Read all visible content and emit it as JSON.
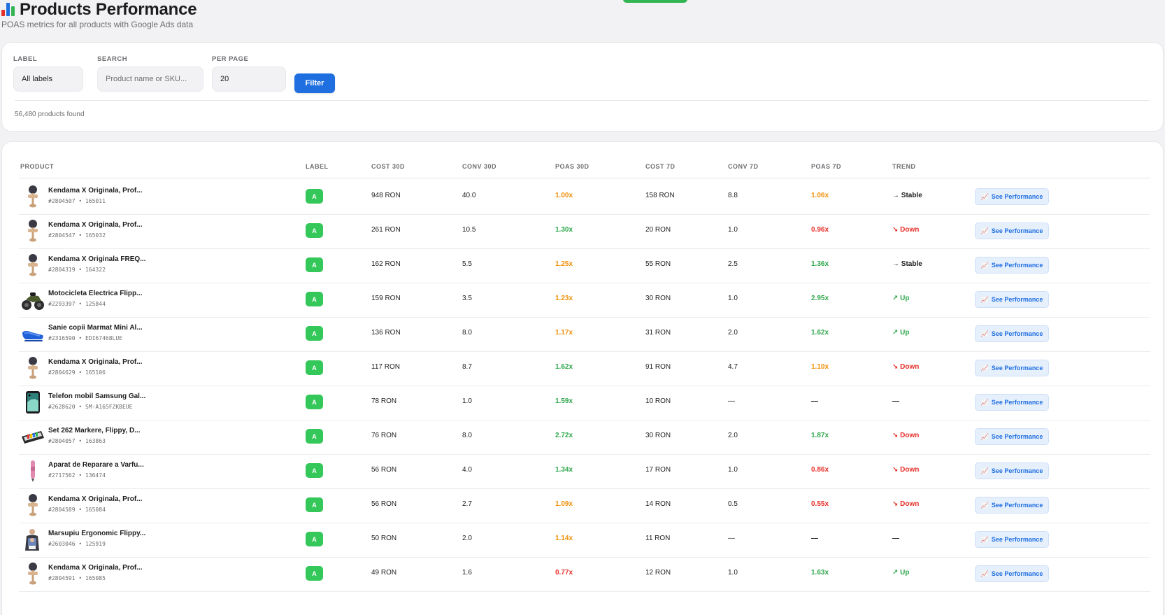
{
  "colors": {
    "accent": "#1f6fe0",
    "badge_green": "#34c759",
    "poas_green": "#30a84d",
    "poas_orange": "#f0900a",
    "poas_red": "#e5302a"
  },
  "header": {
    "icon": "bar-chart-icon",
    "title": "Products Performance",
    "subtitle": "POAS metrics for all products with Google Ads data"
  },
  "filters": {
    "label_label": "LABEL",
    "label_value": "All labels",
    "search_label": "SEARCH",
    "search_placeholder": "Product name or SKU...",
    "per_page_label": "PER PAGE",
    "per_page_value": "20",
    "filter_button": "Filter",
    "count_text": "56,480 products found"
  },
  "table": {
    "headers": {
      "product": "PRODUCT",
      "label": "LABEL",
      "cost30": "COST 30D",
      "conv30": "CONV 30D",
      "poas30": "POAS 30D",
      "cost7": "COST 7D",
      "conv7": "CONV 7D",
      "poas7": "POAS 7D",
      "trend": "TREND"
    },
    "action_label": "See Performance",
    "action_icon": "chart-increasing-icon",
    "rows": [
      {
        "name": "Kendama X Originala, Prof...",
        "sku": "#2804507 • 165011",
        "image": "kendama",
        "label": "A",
        "cost30": "948 RON",
        "conv30": "40.0",
        "poas30": "1.00x",
        "poas30_color": "orange",
        "cost7": "158 RON",
        "conv7": "8.8",
        "poas7": "1.06x",
        "poas7_color": "orange",
        "trend": "→ Stable",
        "trend_color": "dark"
      },
      {
        "name": "Kendama X Originala, Prof...",
        "sku": "#2804547 • 165032",
        "image": "kendama",
        "label": "A",
        "cost30": "261 RON",
        "conv30": "10.5",
        "poas30": "1.30x",
        "poas30_color": "green",
        "cost7": "20 RON",
        "conv7": "1.0",
        "poas7": "0.96x",
        "poas7_color": "red",
        "trend": "↘ Down",
        "trend_color": "red"
      },
      {
        "name": "Kendama X Originala FREQ...",
        "sku": "#2804319 • 164322",
        "image": "kendama",
        "label": "A",
        "cost30": "162 RON",
        "conv30": "5.5",
        "poas30": "1.25x",
        "poas30_color": "orange",
        "cost7": "55 RON",
        "conv7": "2.5",
        "poas7": "1.36x",
        "poas7_color": "green",
        "trend": "→ Stable",
        "trend_color": "dark"
      },
      {
        "name": "Motocicleta Electrica Flipp...",
        "sku": "#2293397 • 125844",
        "image": "motorcycle",
        "label": "A",
        "cost30": "159 RON",
        "conv30": "3.5",
        "poas30": "1.23x",
        "poas30_color": "orange",
        "cost7": "30 RON",
        "conv7": "1.0",
        "poas7": "2.95x",
        "poas7_color": "green",
        "trend": "↗ Up",
        "trend_color": "green"
      },
      {
        "name": "Sanie copii Marmat Mini Al...",
        "sku": "#2316590 • EDI67468LUE",
        "image": "sled",
        "label": "A",
        "cost30": "136 RON",
        "conv30": "8.0",
        "poas30": "1.17x",
        "poas30_color": "orange",
        "cost7": "31 RON",
        "conv7": "2.0",
        "poas7": "1.62x",
        "poas7_color": "green",
        "trend": "↗ Up",
        "trend_color": "green"
      },
      {
        "name": "Kendama X Originala, Prof...",
        "sku": "#2804629 • 165106",
        "image": "kendama",
        "label": "A",
        "cost30": "117 RON",
        "conv30": "8.7",
        "poas30": "1.62x",
        "poas30_color": "green",
        "cost7": "91 RON",
        "conv7": "4.7",
        "poas7": "1.10x",
        "poas7_color": "orange",
        "trend": "↘ Down",
        "trend_color": "red"
      },
      {
        "name": "Telefon mobil Samsung Gal...",
        "sku": "#2628620 • SM-A165FZKBEUE",
        "image": "phone",
        "label": "A",
        "cost30": "78 RON",
        "conv30": "1.0",
        "poas30": "1.59x",
        "poas30_color": "green",
        "cost7": "10 RON",
        "conv7": "—",
        "poas7": "—",
        "poas7_color": "dark",
        "trend": "—",
        "trend_color": "dark"
      },
      {
        "name": "Set 262 Markere, Flippy, D...",
        "sku": "#2804057 • 163863",
        "image": "markers",
        "label": "A",
        "cost30": "76 RON",
        "conv30": "8.0",
        "poas30": "2.72x",
        "poas30_color": "green",
        "cost7": "30 RON",
        "conv7": "2.0",
        "poas7": "1.87x",
        "poas7_color": "green",
        "trend": "↘ Down",
        "trend_color": "red"
      },
      {
        "name": "Aparat de Reparare a Varfu...",
        "sku": "#2717562 • 136474",
        "image": "pen",
        "label": "A",
        "cost30": "56 RON",
        "conv30": "4.0",
        "poas30": "1.34x",
        "poas30_color": "green",
        "cost7": "17 RON",
        "conv7": "1.0",
        "poas7": "0.86x",
        "poas7_color": "red",
        "trend": "↘ Down",
        "trend_color": "red"
      },
      {
        "name": "Kendama X Originala, Prof...",
        "sku": "#2804589 • 165084",
        "image": "kendama",
        "label": "A",
        "cost30": "56 RON",
        "conv30": "2.7",
        "poas30": "1.09x",
        "poas30_color": "orange",
        "cost7": "14 RON",
        "conv7": "0.5",
        "poas7": "0.55x",
        "poas7_color": "red",
        "trend": "↘ Down",
        "trend_color": "red"
      },
      {
        "name": "Marsupiu Ergonomic Flippy...",
        "sku": "#2603046 • 125919",
        "image": "carrier",
        "label": "A",
        "cost30": "50 RON",
        "conv30": "2.0",
        "poas30": "1.14x",
        "poas30_color": "orange",
        "cost7": "11 RON",
        "conv7": "—",
        "poas7": "—",
        "poas7_color": "dark",
        "trend": "—",
        "trend_color": "dark"
      },
      {
        "name": "Kendama X Originala, Prof...",
        "sku": "#2804591 • 165085",
        "image": "kendama",
        "label": "A",
        "cost30": "49 RON",
        "conv30": "1.6",
        "poas30": "0.77x",
        "poas30_color": "red",
        "cost7": "12 RON",
        "conv7": "1.0",
        "poas7": "1.63x",
        "poas7_color": "green",
        "trend": "↗ Up",
        "trend_color": "green"
      }
    ]
  }
}
